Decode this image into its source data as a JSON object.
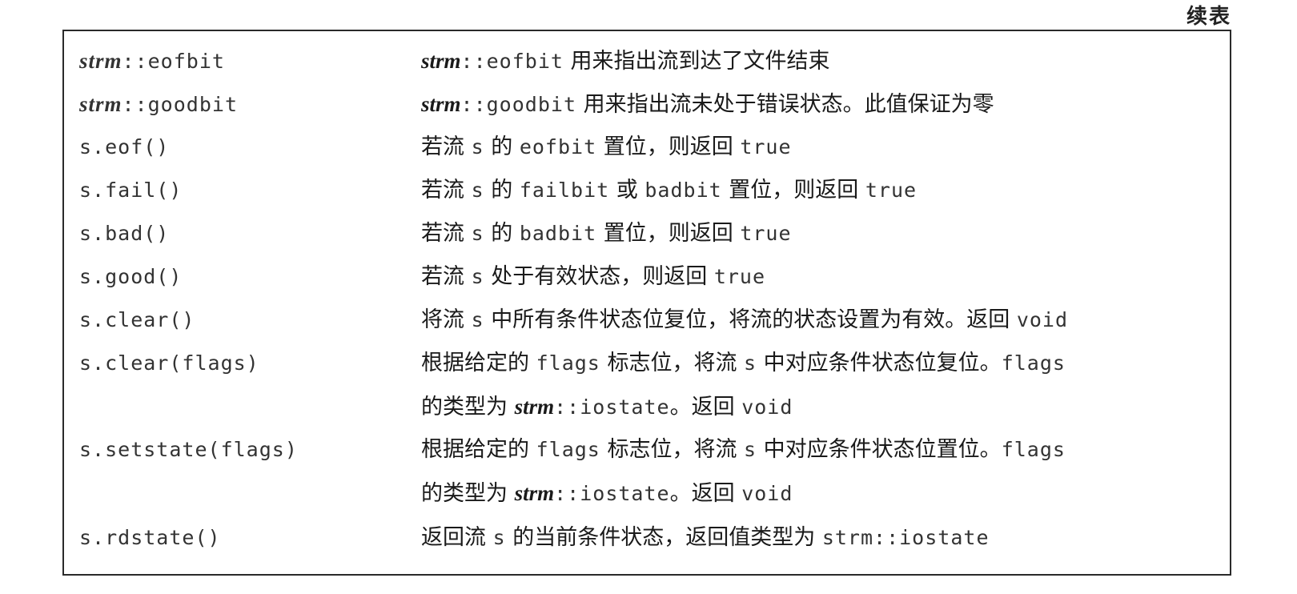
{
  "header": {
    "continued_label": "续表"
  },
  "rows": [
    {
      "op_it": "strm",
      "op_code": "::eofbit",
      "desc": [
        {
          "it": "strm"
        },
        {
          "code": "::eofbit"
        },
        {
          "text": " 用来指出流到达了文件结束"
        }
      ]
    },
    {
      "op_it": "strm",
      "op_code": "::goodbit",
      "desc": [
        {
          "it": "strm"
        },
        {
          "code": "::goodbit"
        },
        {
          "text": " 用来指出流未处于错误状态。此值保证为零"
        }
      ]
    },
    {
      "op_code": "s.eof()",
      "desc": [
        {
          "text": "若流 "
        },
        {
          "code": "s"
        },
        {
          "text": " 的 "
        },
        {
          "code": "eofbit"
        },
        {
          "text": " 置位，则返回 "
        },
        {
          "code": "true"
        }
      ]
    },
    {
      "op_code": "s.fail()",
      "desc": [
        {
          "text": "若流 "
        },
        {
          "code": "s"
        },
        {
          "text": " 的 "
        },
        {
          "code": "failbit"
        },
        {
          "text": " 或 "
        },
        {
          "code": "badbit"
        },
        {
          "text": " 置位，则返回 "
        },
        {
          "code": "true"
        }
      ]
    },
    {
      "op_code": "s.bad()",
      "desc": [
        {
          "text": "若流 "
        },
        {
          "code": "s"
        },
        {
          "text": " 的 "
        },
        {
          "code": "badbit"
        },
        {
          "text": " 置位，则返回 "
        },
        {
          "code": "true"
        }
      ]
    },
    {
      "op_code": "s.good()",
      "desc": [
        {
          "text": "若流 "
        },
        {
          "code": "s"
        },
        {
          "text": " 处于有效状态，则返回 "
        },
        {
          "code": "true"
        }
      ]
    },
    {
      "op_code": "s.clear()",
      "desc": [
        {
          "text": "将流 "
        },
        {
          "code": "s"
        },
        {
          "text": " 中所有条件状态位复位，将流的状态设置为有效。返回 "
        },
        {
          "code": "void"
        }
      ]
    },
    {
      "op_code": "s.clear(flags)",
      "desc": [
        {
          "text": "根据给定的 "
        },
        {
          "code": "flags"
        },
        {
          "text": " 标志位，将流 "
        },
        {
          "code": "s"
        },
        {
          "text": " 中对应条件状态位复位。"
        },
        {
          "code": "flags"
        },
        {
          "br": true
        },
        {
          "text": "的类型为 "
        },
        {
          "it": "strm"
        },
        {
          "code": "::iostate"
        },
        {
          "text": "。返回 "
        },
        {
          "code": "void"
        }
      ]
    },
    {
      "op_code": "s.setstate(flags)",
      "desc": [
        {
          "text": "根据给定的 "
        },
        {
          "code": "flags"
        },
        {
          "text": " 标志位，将流 "
        },
        {
          "code": "s"
        },
        {
          "text": " 中对应条件状态位置位。"
        },
        {
          "code": "flags"
        },
        {
          "br": true
        },
        {
          "text": "的类型为 "
        },
        {
          "it": "strm"
        },
        {
          "code": "::iostate"
        },
        {
          "text": "。返回 "
        },
        {
          "code": "void"
        }
      ]
    },
    {
      "op_code": "s.rdstate()",
      "desc": [
        {
          "text": "返回流 "
        },
        {
          "code": "s"
        },
        {
          "text": " 的当前条件状态，返回值类型为 "
        },
        {
          "code": "strm::iostate"
        }
      ]
    }
  ]
}
